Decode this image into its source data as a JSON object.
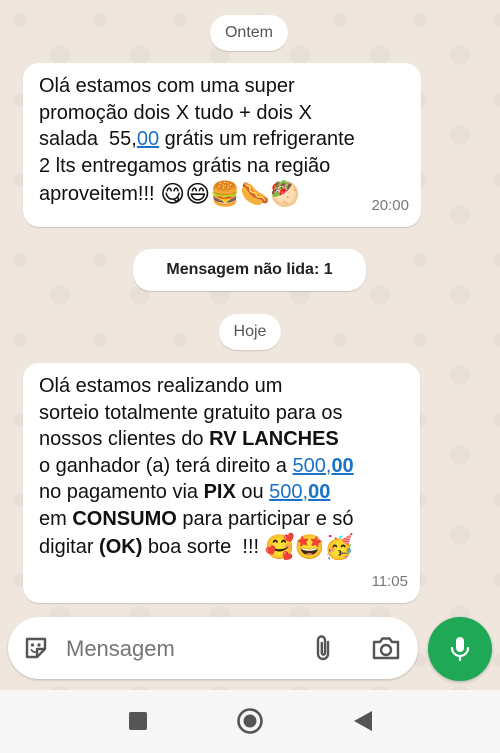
{
  "chat": {
    "date_yesterday": "Ontem",
    "message1": {
      "line1": "Olá estamos com uma super",
      "line2": "promoção dois X tudo + dois X",
      "line3_a": "salada  55,",
      "line3_link": "00",
      "line3_b": " grátis um refrigerante",
      "line4": "2 lts entregamos grátis na região",
      "line5": "aproveitem!!! ",
      "emojis": "😋😄🍔🌭🥙",
      "time": "20:00"
    },
    "unread_label": "Mensagem não lida: 1",
    "date_today": "Hoje",
    "message2": {
      "line1": "Olá estamos realizando um",
      "line2": "sorteio totalmente gratuito para os",
      "line3_a": "nossos clientes do ",
      "line3_bold": "RV LANCHES",
      "line4_a": "o ganhador (a) terá direito a ",
      "line4_link_a": "500,",
      "line4_link_b": "00",
      "line5_a": "no pagamento via ",
      "line5_bold": "PIX",
      "line5_b": " ou ",
      "line5_link_a": "500,",
      "line5_link_b": "00",
      "line6_a": "em ",
      "line6_bold": "CONSUMO",
      "line6_b": " para participar e só",
      "line7_a": "digitar ",
      "line7_bold": "(OK)",
      "line7_b": " boa sorte  !!! ",
      "emojis": "🥰🤩🥳",
      "time": "11:05"
    }
  },
  "composer": {
    "placeholder": "Mensagem",
    "icons": [
      "sticker-icon",
      "paperclip-icon",
      "camera-icon",
      "microphone-icon"
    ]
  },
  "navbar": {
    "icons": [
      "recents-square-icon",
      "home-circle-icon",
      "back-triangle-icon"
    ]
  },
  "colors": {
    "wallpaper": "#efe7de",
    "bubble": "#ffffff",
    "link": "#1a73c8",
    "mic_button": "#1fa855"
  }
}
